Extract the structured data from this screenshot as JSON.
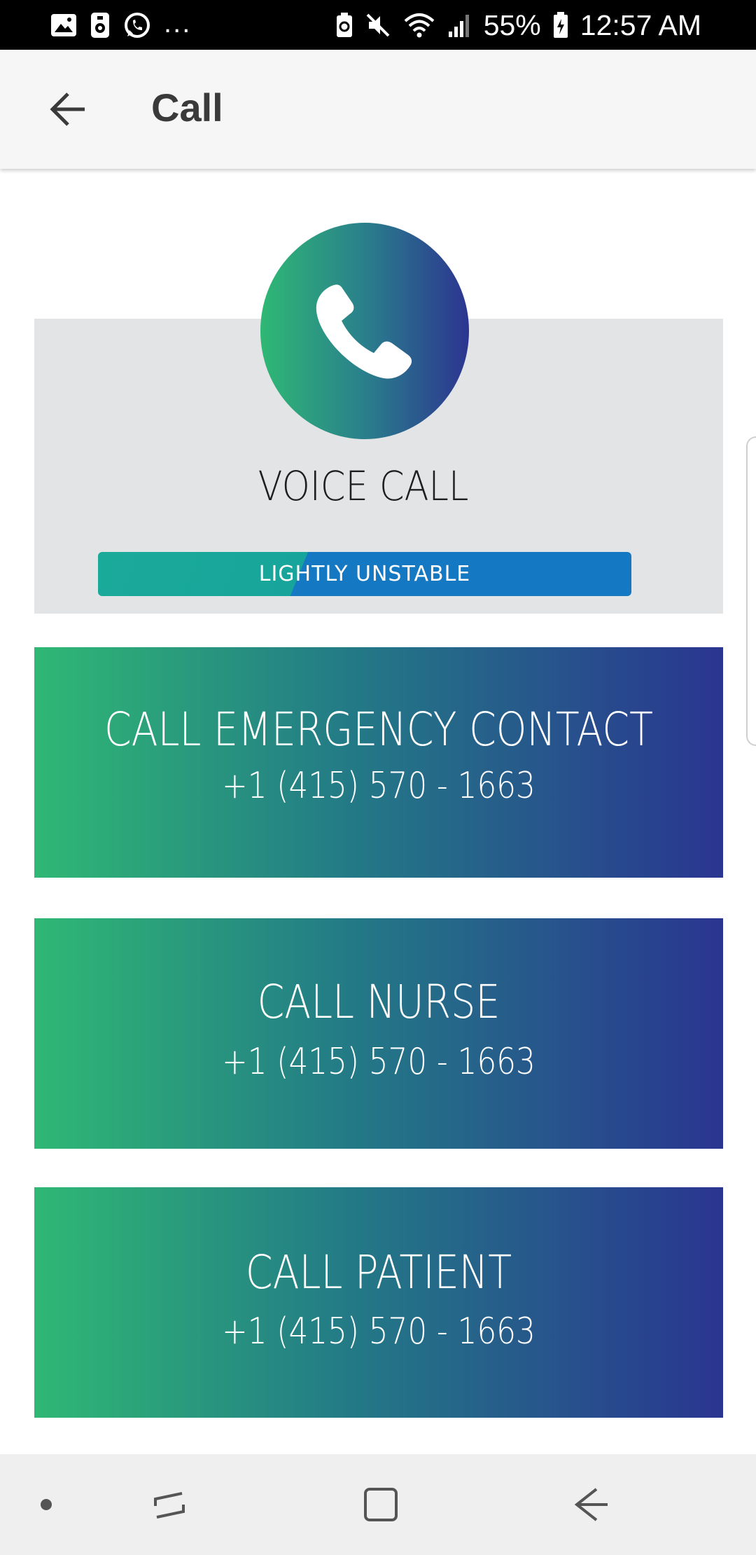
{
  "status_bar": {
    "notification_icons": [
      "image-icon",
      "storage-icon",
      "whatsapp-icon"
    ],
    "overflow": "...",
    "battery_percent": "55%",
    "time": "12:57 AM"
  },
  "app_bar": {
    "title": "Call"
  },
  "voice_call": {
    "title": "VOICE CALL",
    "connection_status": "LIGHTLY UNSTABLE"
  },
  "call_buttons": [
    {
      "label": "CALL EMERGENCY CONTACT",
      "phone": "+1 (415) 570 - 1663"
    },
    {
      "label": "CALL NURSE",
      "phone": "+1 (415) 570 - 1663"
    },
    {
      "label": "CALL PATIENT",
      "phone": "+1 (415) 570 - 1663"
    }
  ],
  "colors": {
    "gradient_start": "#2fb874",
    "gradient_end": "#2a3590",
    "badge_left": "#1aaa9a",
    "badge_right": "#1478c2",
    "card_background": "#e3e4e6"
  },
  "nav_bar": {
    "items": [
      "dot-icon",
      "recents-icon",
      "home-icon",
      "back-icon"
    ]
  }
}
